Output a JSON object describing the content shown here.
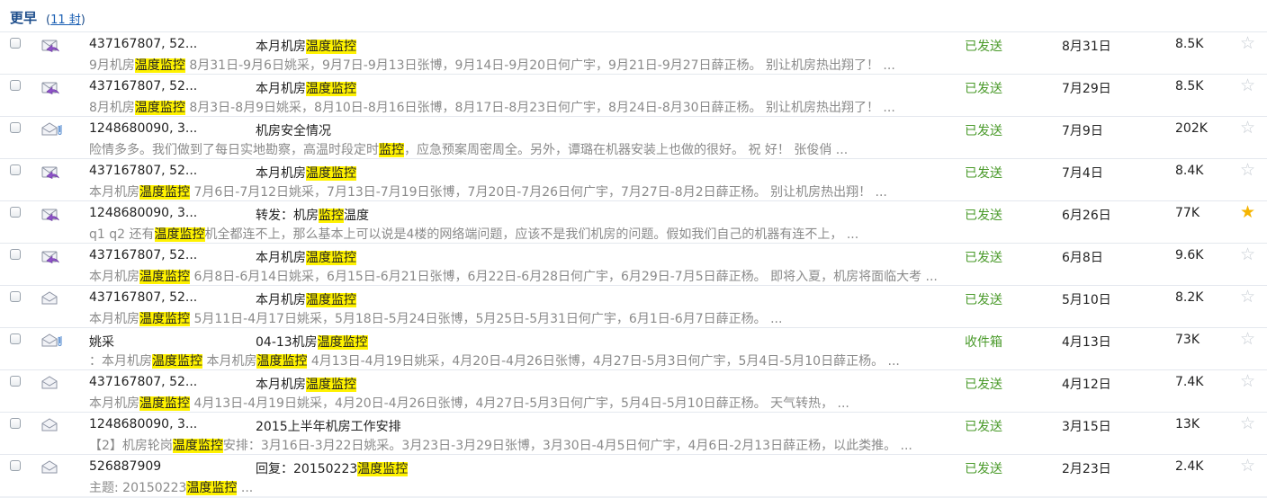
{
  "group": {
    "title": "更早",
    "count_prefix": "(",
    "count": "11 封",
    "count_suffix": ")"
  },
  "colors": {
    "header_text": "#1e4e8c",
    "folder_text": "#4a9a2a",
    "highlight": "#fff200",
    "preview_text": "#8a8a8a",
    "star_active": "#f5b400",
    "star_inactive": "#c6ccd3"
  },
  "emails": [
    {
      "icon": "reply-mail-icon",
      "attachment": false,
      "sender": "437167807, 52...",
      "subject": [
        {
          "t": "本月机房"
        },
        {
          "t": "温度监控",
          "h": true
        }
      ],
      "preview": [
        {
          "t": "9月机房"
        },
        {
          "t": "温度监控",
          "h": true
        },
        {
          "t": " 8月31日-9月6日姚采，9月7日-9月13日张博，9月14日-9月20日何广宇，9月21日-9月27日薛正杨。 别让机房热出翔了！ ..."
        }
      ],
      "folder": "已发送",
      "date": "8月31日",
      "size": "8.5K",
      "starred": false
    },
    {
      "icon": "reply-mail-icon",
      "attachment": false,
      "sender": "437167807, 52...",
      "subject": [
        {
          "t": "本月机房"
        },
        {
          "t": "温度监控",
          "h": true
        }
      ],
      "preview": [
        {
          "t": "8月机房"
        },
        {
          "t": "温度监控",
          "h": true
        },
        {
          "t": " 8月3日-8月9日姚采，8月10日-8月16日张博，8月17日-8月23日何广宇，8月24日-8月30日薛正杨。 别让机房热出翔了！ ..."
        }
      ],
      "folder": "已发送",
      "date": "7月29日",
      "size": "8.5K",
      "starred": false
    },
    {
      "icon": "read-mail-icon",
      "attachment": true,
      "sender": "1248680090, 3...",
      "subject": [
        {
          "t": "机房安全情况"
        }
      ],
      "preview": [
        {
          "t": "险情多多。我们做到了每日实地勘察，高温时段定时"
        },
        {
          "t": "监控",
          "h": true
        },
        {
          "t": "，应急预案周密周全。另外，谭璐在机器安装上也做的很好。 祝 好！ 张俊俏 ..."
        }
      ],
      "folder": "已发送",
      "date": "7月9日",
      "size": "202K",
      "starred": false
    },
    {
      "icon": "reply-mail-icon",
      "attachment": false,
      "sender": "437167807, 52...",
      "subject": [
        {
          "t": "本月机房"
        },
        {
          "t": "温度监控",
          "h": true
        }
      ],
      "preview": [
        {
          "t": "本月机房"
        },
        {
          "t": "温度监控",
          "h": true
        },
        {
          "t": " 7月6日-7月12日姚采，7月13日-7月19日张博，7月20日-7月26日何广宇，7月27日-8月2日薛正杨。 别让机房热出翔！ ..."
        }
      ],
      "folder": "已发送",
      "date": "7月4日",
      "size": "8.4K",
      "starred": false
    },
    {
      "icon": "reply-mail-icon",
      "attachment": false,
      "sender": "1248680090, 3...",
      "subject": [
        {
          "t": "转发：机房"
        },
        {
          "t": "监控",
          "h": true
        },
        {
          "t": "温度"
        }
      ],
      "preview": [
        {
          "t": "q1 q2 还有"
        },
        {
          "t": "温度监控",
          "h": true
        },
        {
          "t": "机全都连不上，那么基本上可以说是4楼的网络端问题，应该不是我们机房的问题。假如我们自己的机器有连不上， ..."
        }
      ],
      "folder": "已发送",
      "date": "6月26日",
      "size": "77K",
      "starred": true
    },
    {
      "icon": "reply-mail-icon",
      "attachment": false,
      "sender": "437167807, 52...",
      "subject": [
        {
          "t": "本月机房"
        },
        {
          "t": "温度监控",
          "h": true
        }
      ],
      "preview": [
        {
          "t": "本月机房"
        },
        {
          "t": "温度监控",
          "h": true
        },
        {
          "t": " 6月8日-6月14日姚采，6月15日-6月21日张博，6月22日-6月28日何广宇，6月29日-7月5日薛正杨。 即将入夏，机房将面临大考 ..."
        }
      ],
      "folder": "已发送",
      "date": "6月8日",
      "size": "9.6K",
      "starred": false
    },
    {
      "icon": "read-mail-icon",
      "attachment": false,
      "sender": "437167807, 52...",
      "subject": [
        {
          "t": "本月机房"
        },
        {
          "t": "温度监控",
          "h": true
        }
      ],
      "preview": [
        {
          "t": "本月机房"
        },
        {
          "t": "温度监控",
          "h": true
        },
        {
          "t": " 5月11日-4月17日姚采，5月18日-5月24日张博，5月25日-5月31日何广宇，6月1日-6月7日薛正杨。 ..."
        }
      ],
      "folder": "已发送",
      "date": "5月10日",
      "size": "8.2K",
      "starred": false
    },
    {
      "icon": "read-mail-icon",
      "attachment": true,
      "sender": "姚采",
      "subject": [
        {
          "t": "04-13机房"
        },
        {
          "t": "温度监控",
          "h": true
        }
      ],
      "preview": [
        {
          "t": "：本月机房"
        },
        {
          "t": "温度监控",
          "h": true
        },
        {
          "t": " 本月机房"
        },
        {
          "t": "温度监控",
          "h": true
        },
        {
          "t": " 4月13日-4月19日姚采，4月20日-4月26日张博，4月27日-5月3日何广宇，5月4日-5月10日薛正杨。 ..."
        }
      ],
      "folder": "收件箱",
      "date": "4月13日",
      "size": "73K",
      "starred": false
    },
    {
      "icon": "read-mail-icon",
      "attachment": false,
      "sender": "437167807, 52...",
      "subject": [
        {
          "t": "本月机房"
        },
        {
          "t": "温度监控",
          "h": true
        }
      ],
      "preview": [
        {
          "t": "本月机房"
        },
        {
          "t": "温度监控",
          "h": true
        },
        {
          "t": " 4月13日-4月19日姚采，4月20日-4月26日张博，4月27日-5月3日何广宇，5月4日-5月10日薛正杨。 天气转热， ..."
        }
      ],
      "folder": "已发送",
      "date": "4月12日",
      "size": "7.4K",
      "starred": false
    },
    {
      "icon": "read-mail-icon",
      "attachment": false,
      "sender": "1248680090, 3...",
      "subject": [
        {
          "t": "2015上半年机房工作安排"
        }
      ],
      "preview": [
        {
          "t": "【2】机房轮岗"
        },
        {
          "t": "温度监控",
          "h": true
        },
        {
          "t": "安排：3月16日-3月22日姚采。3月23日-3月29日张博，3月30日-4月5日何广宇，4月6日-2月13日薛正杨，以此类推。 ..."
        }
      ],
      "folder": "已发送",
      "date": "3月15日",
      "size": "13K",
      "starred": false
    },
    {
      "icon": "read-mail-icon",
      "attachment": false,
      "sender": "526887909",
      "subject": [
        {
          "t": "回复：20150223"
        },
        {
          "t": "温度监控",
          "h": true
        }
      ],
      "preview": [
        {
          "t": "主题: 20150223"
        },
        {
          "t": "温度监控",
          "h": true
        },
        {
          "t": " ..."
        }
      ],
      "folder": "已发送",
      "date": "2月23日",
      "size": "2.4K",
      "starred": false
    }
  ]
}
